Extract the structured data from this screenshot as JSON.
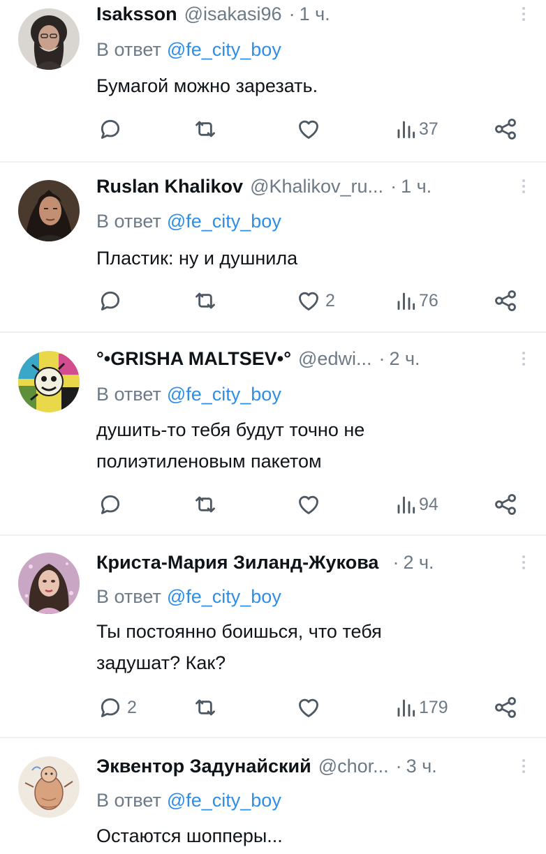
{
  "colors": {
    "accent": "#2f8ee8",
    "muted": "#6d7a86",
    "text": "#0f1419",
    "divider": "#eef1f3"
  },
  "icons": [
    "reply-icon",
    "retweet-icon",
    "like-icon",
    "views-icon",
    "share-icon",
    "more-icon"
  ],
  "tweets": [
    {
      "name": "Isaksson",
      "handle": "@isakasi96",
      "sep": "·",
      "time": "1 ч.",
      "reply_prefix": "В ответ",
      "reply_to": "@fe_city_boy",
      "text": "Бумагой можно зарезать.",
      "replies": "",
      "retweets": "",
      "likes": "",
      "views": "37"
    },
    {
      "name": "Ruslan Khalikov",
      "handle": "@Khalikov_ru...",
      "sep": "·",
      "time": "1 ч.",
      "reply_prefix": "В ответ",
      "reply_to": "@fe_city_boy",
      "text": "Пластик: ну и душнила",
      "replies": "",
      "retweets": "",
      "likes": "2",
      "views": "76"
    },
    {
      "name": "°•GRISHA MALTSEV•°",
      "handle": "@edwi...",
      "sep": "·",
      "time": "2 ч.",
      "reply_prefix": "В ответ",
      "reply_to": "@fe_city_boy",
      "text": "душить-то тебя будут точно не полиэтиленовым пакетом",
      "replies": "",
      "retweets": "",
      "likes": "",
      "views": "94"
    },
    {
      "name": "Криста-Мария Зиланд-Жукова",
      "handle": "",
      "sep": "·",
      "time": "2 ч.",
      "reply_prefix": "В ответ",
      "reply_to": "@fe_city_boy",
      "text": "Ты постоянно боишься, что тебя задушат? Как?",
      "replies": "2",
      "retweets": "",
      "likes": "",
      "views": "179"
    },
    {
      "name": "Эквентор Задунайский",
      "handle": "@chor...",
      "sep": "·",
      "time": "3 ч.",
      "reply_prefix": "В ответ",
      "reply_to": "@fe_city_boy",
      "text": "Остаются шопперы...",
      "replies": "",
      "retweets": "",
      "likes": "",
      "views": ""
    }
  ]
}
